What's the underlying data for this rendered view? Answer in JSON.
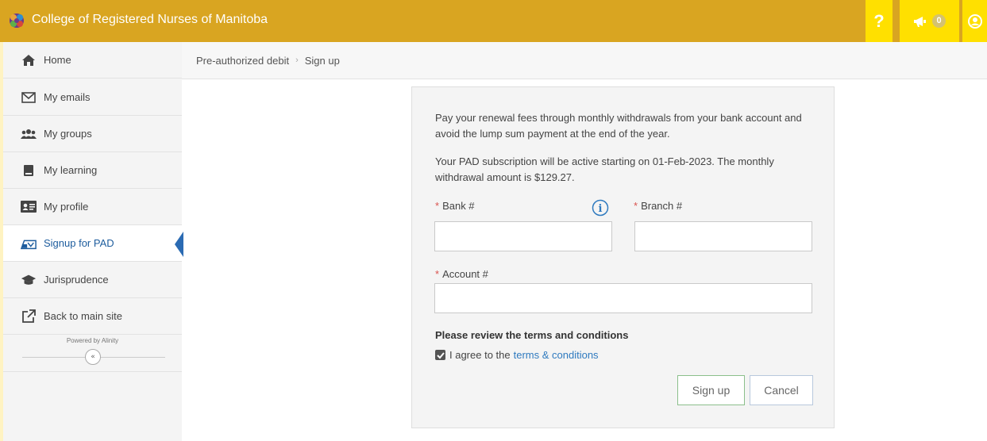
{
  "header": {
    "title": "College of Registered Nurses of Manitoba",
    "help_label": "?",
    "notification_count": "0",
    "colors": {
      "bar": "#d9a521",
      "buttons": "#ffe000"
    }
  },
  "sidebar": {
    "items": [
      {
        "label": "Home",
        "icon": "home-icon"
      },
      {
        "label": "My emails",
        "icon": "envelope-icon"
      },
      {
        "label": "My groups",
        "icon": "users-icon"
      },
      {
        "label": "My learning",
        "icon": "book-icon"
      },
      {
        "label": "My profile",
        "icon": "id-card-icon"
      },
      {
        "label": "Signup for PAD",
        "icon": "pad-icon",
        "active": true
      },
      {
        "label": "Jurisprudence",
        "icon": "graduation-cap-icon"
      },
      {
        "label": "Back to main site",
        "icon": "external-link-icon"
      }
    ],
    "powered_by": "Powered by Alinity"
  },
  "breadcrumb": {
    "parent": "Pre-authorized debit",
    "current": "Sign up"
  },
  "form": {
    "intro": "Pay your renewal fees through monthly withdrawals from your bank account and avoid the lump sum payment at the end of the year.",
    "subscription_note": "Your PAD subscription will be active starting on 01-Feb-2023. The monthly withdrawal amount is $129.27.",
    "bank_label": "Bank #",
    "branch_label": "Branch #",
    "account_label": "Account #",
    "bank_value": "",
    "branch_value": "",
    "account_value": "",
    "required_marker": "*",
    "terms_title": "Please review the terms and conditions",
    "agree_text": "I agree to the",
    "terms_link": "terms & conditions",
    "agree_checked": true,
    "signup_label": "Sign up",
    "cancel_label": "Cancel"
  }
}
